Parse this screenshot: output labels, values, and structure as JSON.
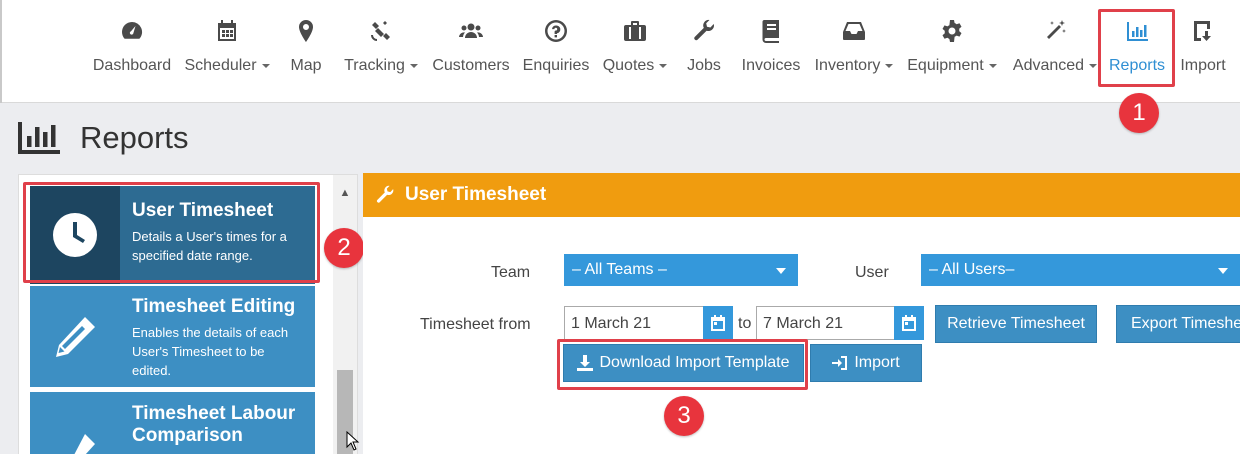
{
  "nav": {
    "items": [
      {
        "label": "Dashboard",
        "icon": "gauge-icon",
        "caret": false
      },
      {
        "label": "Scheduler",
        "icon": "calendar-icon",
        "caret": true
      },
      {
        "label": "Map",
        "icon": "map-pin-icon",
        "caret": false
      },
      {
        "label": "Tracking",
        "icon": "satellite-icon",
        "caret": true
      },
      {
        "label": "Customers",
        "icon": "users-icon",
        "caret": false
      },
      {
        "label": "Enquiries",
        "icon": "question-icon",
        "caret": false
      },
      {
        "label": "Quotes",
        "icon": "briefcase-icon",
        "caret": true
      },
      {
        "label": "Jobs",
        "icon": "wrench-icon",
        "caret": false
      },
      {
        "label": "Invoices",
        "icon": "book-icon",
        "caret": false
      },
      {
        "label": "Inventory",
        "icon": "inbox-icon",
        "caret": true
      },
      {
        "label": "Equipment",
        "icon": "gear-icon",
        "caret": true
      },
      {
        "label": "Advanced",
        "icon": "magic-wand-icon",
        "caret": true
      },
      {
        "label": "Reports",
        "icon": "bar-chart-icon",
        "caret": false,
        "active": true
      },
      {
        "label": "Import",
        "icon": "import-icon",
        "caret": false
      }
    ]
  },
  "page": {
    "title": "Reports"
  },
  "reports": [
    {
      "title": "User Timesheet",
      "description": "Details a User's times for a specified date range.",
      "icon": "clock-icon",
      "selected": true
    },
    {
      "title": "Timesheet Editing",
      "description": "Enables the details of each User's Timesheet to be edited.",
      "icon": "pencil-icon"
    },
    {
      "title": "Timesheet Labour Comparison",
      "description": "",
      "icon": "pencil-icon"
    }
  ],
  "panel": {
    "title": "User Timesheet",
    "team_label": "Team",
    "team_value": "– All Teams –",
    "user_label": "User",
    "user_value": "– All Users–",
    "from_label": "Timesheet from",
    "date_from": "1 March 21",
    "to_label": "to",
    "date_to": "7 March 21",
    "retrieve_label": "Retrieve Timesheet",
    "export_label": "Export Timesheet",
    "download_label": "Download Import Template",
    "import_label": "Import"
  },
  "annotations": {
    "one": "1",
    "two": "2",
    "three": "3"
  },
  "colors": {
    "accent": "#3d8fc3",
    "header": "#f09c0f",
    "annotation": "#e8343d",
    "active_nav": "#2f8fd3"
  }
}
